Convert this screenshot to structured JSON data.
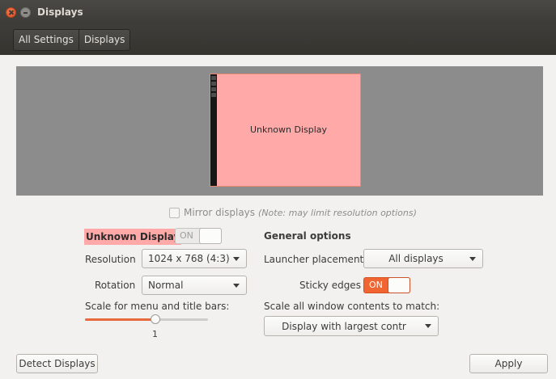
{
  "window": {
    "title": "Displays"
  },
  "breadcrumbs": [
    {
      "label": "All Settings"
    },
    {
      "label": "Displays"
    }
  ],
  "preview": {
    "monitor_label": "Unknown Display"
  },
  "mirror": {
    "label": "Mirror displays",
    "note": "(Note: may limit resolution options)",
    "checked": false
  },
  "display": {
    "name": "Unknown Display",
    "enabled_toggle": "ON",
    "enabled": false,
    "resolution_label": "Resolution",
    "resolution_value": "1024 x 768 (4:3)",
    "rotation_label": "Rotation",
    "rotation_value": "Normal",
    "scale_label": "Scale for menu and title bars:",
    "scale_value": "1",
    "scale_fraction": 0.57
  },
  "general": {
    "heading": "General options",
    "launcher_label": "Launcher placement",
    "launcher_value": "All displays",
    "sticky_label": "Sticky edges",
    "sticky_toggle": "ON",
    "sticky_enabled": true,
    "scale_all_label": "Scale all window contents to match:",
    "scale_all_value": "Display with largest contr"
  },
  "buttons": {
    "detect": "Detect Displays",
    "apply": "Apply"
  },
  "icons": {
    "close": "close-icon",
    "minimize": "minimize-icon",
    "dropdown": "chevron-down-icon"
  },
  "colors": {
    "accent": "#f06532",
    "selected_display": "#ffa9a9",
    "titlebar": "#3c3b37"
  }
}
